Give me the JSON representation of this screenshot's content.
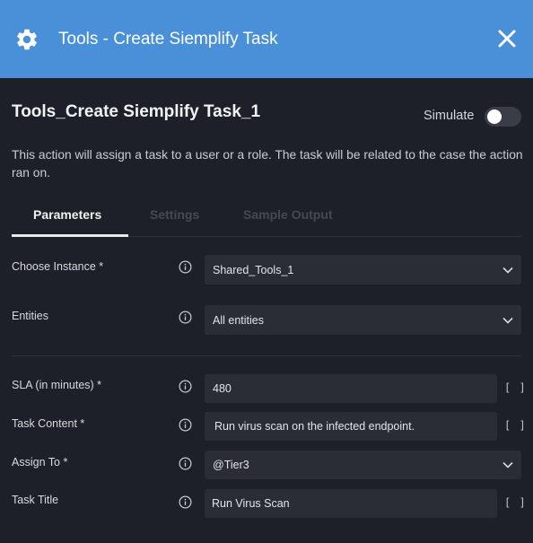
{
  "header": {
    "title": "Tools - Create Siemplify Task",
    "icon": "gear-icon",
    "close_icon": "close-icon"
  },
  "action": {
    "title": "Tools_Create Siemplify Task_1",
    "simulate_label": "Simulate",
    "simulate_on": false,
    "description": "This action will assign a task to a user or a role. The task will be related to the case the action ran on."
  },
  "tabs": [
    {
      "label": "Parameters",
      "active": true
    },
    {
      "label": "Settings",
      "active": false
    },
    {
      "label": "Sample Output",
      "active": false
    }
  ],
  "params": {
    "instance": {
      "label": "Choose Instance *",
      "value": "Shared_Tools_1"
    },
    "entities": {
      "label": "Entities",
      "value": "All entities"
    },
    "sla": {
      "label": "SLA (in minutes)  *",
      "value": "480"
    },
    "task_content": {
      "label": "Task Content  *",
      "value": "Run  virus scan on the infected endpoint."
    },
    "assign_to": {
      "label": "Assign To  *",
      "value": "@Tier3"
    },
    "task_title": {
      "label": "Task Title",
      "value": "Run Virus Scan"
    }
  },
  "bracket_glyph": "[ ]",
  "colors": {
    "header_bg": "#4a90d9",
    "panel_bg": "#1e2029",
    "field_bg": "#2a2c36"
  }
}
